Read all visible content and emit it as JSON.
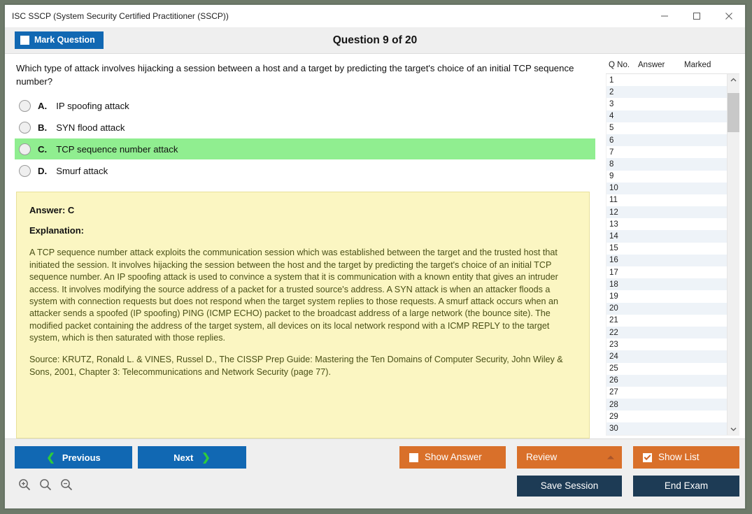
{
  "window": {
    "title": "ISC SSCP (System Security Certified Practitioner (SSCP))",
    "controls": {
      "minimize": "minimize-icon",
      "maximize": "maximize-icon",
      "close": "close-icon"
    }
  },
  "header": {
    "mark_question_label": "Mark Question",
    "mark_question_checked": false,
    "question_title": "Question 9 of 20"
  },
  "question": {
    "text": "Which type of attack involves hijacking a session between a host and a target by predicting the target's choice of an initial TCP sequence number?",
    "options": [
      {
        "letter": "A.",
        "text": "IP spoofing attack",
        "selected": false,
        "correct": false
      },
      {
        "letter": "B.",
        "text": "SYN flood attack",
        "selected": false,
        "correct": false
      },
      {
        "letter": "C.",
        "text": "TCP sequence number attack",
        "selected": false,
        "correct": true
      },
      {
        "letter": "D.",
        "text": "Smurf attack",
        "selected": false,
        "correct": false
      }
    ]
  },
  "explanation": {
    "answer_label": "Answer: C",
    "explanation_label": "Explanation:",
    "body": "A TCP sequence number attack exploits the communication session which was established between the target and the trusted host that initiated the session. It involves hijacking the session between the host and the target by predicting the target's choice of an initial TCP sequence number. An IP spoofing attack is used to convince a system that it is communication with a known entity that gives an intruder access. It involves modifying the source address of a packet for a trusted source's address. A SYN attack is when an attacker floods a system with connection requests but does not respond when the target system replies to those requests. A smurf attack occurs when an attacker sends a spoofed (IP spoofing) PING (ICMP ECHO) packet to the broadcast address of a large network (the bounce site). The modified packet containing the address of the target system, all devices on its local network respond with a ICMP REPLY to the target system, which is then saturated with those replies.",
    "source": "Source: KRUTZ, Ronald L. & VINES, Russel D., The CISSP Prep Guide: Mastering the Ten Domains of Computer Security, John Wiley & Sons, 2001, Chapter 3: Telecommunications and Network Security (page 77)."
  },
  "question_list": {
    "columns": [
      "Q No.",
      "Answer",
      "Marked"
    ],
    "rows": [
      {
        "no": "1",
        "answer": "",
        "marked": ""
      },
      {
        "no": "2",
        "answer": "",
        "marked": ""
      },
      {
        "no": "3",
        "answer": "",
        "marked": ""
      },
      {
        "no": "4",
        "answer": "",
        "marked": ""
      },
      {
        "no": "5",
        "answer": "",
        "marked": ""
      },
      {
        "no": "6",
        "answer": "",
        "marked": ""
      },
      {
        "no": "7",
        "answer": "",
        "marked": ""
      },
      {
        "no": "8",
        "answer": "",
        "marked": ""
      },
      {
        "no": "9",
        "answer": "",
        "marked": ""
      },
      {
        "no": "10",
        "answer": "",
        "marked": ""
      },
      {
        "no": "11",
        "answer": "",
        "marked": ""
      },
      {
        "no": "12",
        "answer": "",
        "marked": ""
      },
      {
        "no": "13",
        "answer": "",
        "marked": ""
      },
      {
        "no": "14",
        "answer": "",
        "marked": ""
      },
      {
        "no": "15",
        "answer": "",
        "marked": ""
      },
      {
        "no": "16",
        "answer": "",
        "marked": ""
      },
      {
        "no": "17",
        "answer": "",
        "marked": ""
      },
      {
        "no": "18",
        "answer": "",
        "marked": ""
      },
      {
        "no": "19",
        "answer": "",
        "marked": ""
      },
      {
        "no": "20",
        "answer": "",
        "marked": ""
      },
      {
        "no": "21",
        "answer": "",
        "marked": ""
      },
      {
        "no": "22",
        "answer": "",
        "marked": ""
      },
      {
        "no": "23",
        "answer": "",
        "marked": ""
      },
      {
        "no": "24",
        "answer": "",
        "marked": ""
      },
      {
        "no": "25",
        "answer": "",
        "marked": ""
      },
      {
        "no": "26",
        "answer": "",
        "marked": ""
      },
      {
        "no": "27",
        "answer": "",
        "marked": ""
      },
      {
        "no": "28",
        "answer": "",
        "marked": ""
      },
      {
        "no": "29",
        "answer": "",
        "marked": ""
      },
      {
        "no": "30",
        "answer": "",
        "marked": ""
      }
    ]
  },
  "footer": {
    "previous_label": "Previous",
    "next_label": "Next",
    "show_answer_label": "Show Answer",
    "show_answer_checked": false,
    "review_label": "Review",
    "show_list_label": "Show List",
    "show_list_checked": true,
    "save_session_label": "Save Session",
    "end_exam_label": "End Exam",
    "zoom_icons": [
      "zoom-in-icon",
      "zoom-reset-icon",
      "zoom-out-icon"
    ]
  },
  "colors": {
    "primary_blue": "#1168b3",
    "orange": "#d9702a",
    "navy": "#1d3b55",
    "correct_green": "#90ee90",
    "explanation_yellow": "#fbf6c2",
    "explanation_text": "#4a5017"
  }
}
